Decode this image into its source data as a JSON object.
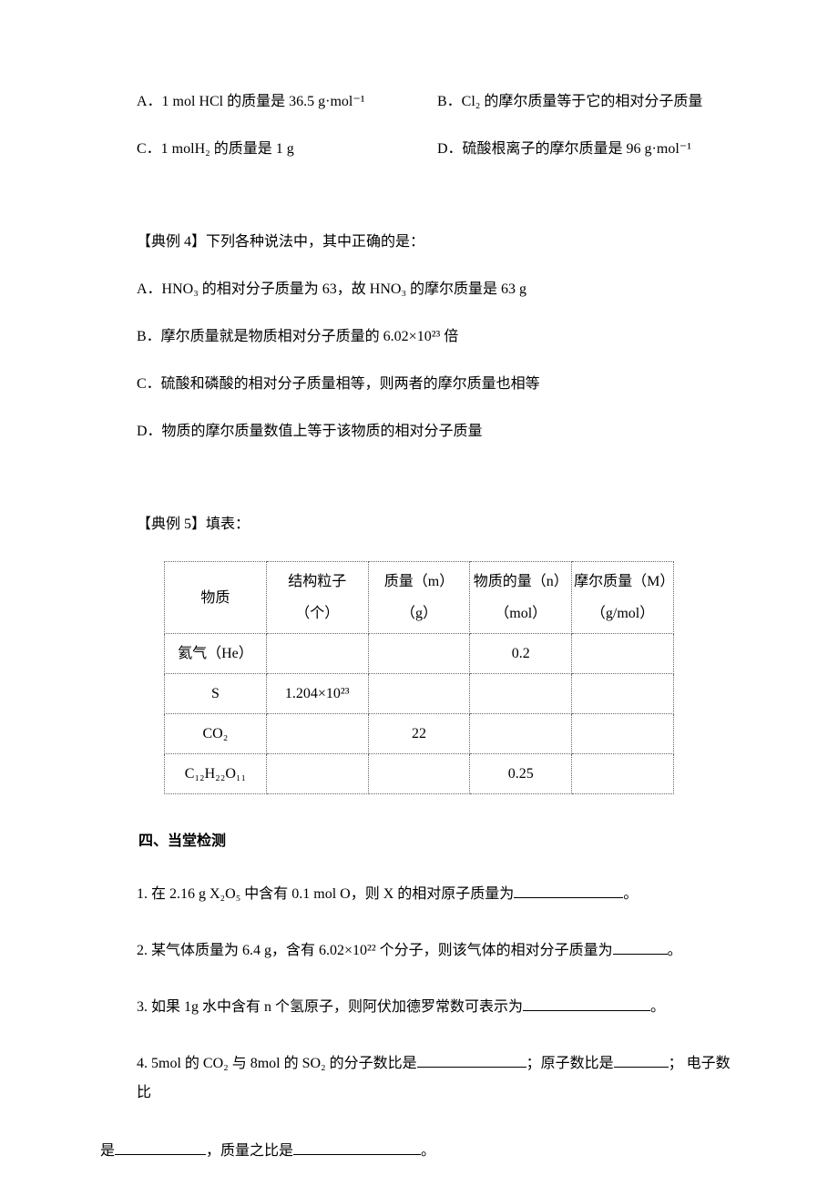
{
  "top": {
    "a": "A．1 mol HCl 的质量是 36.5 g·mol⁻¹",
    "b": "B．Cl₂ 的摩尔质量等于它的相对分子质量",
    "c": "C．1 molH₂ 的质量是 1 g",
    "d": "D．硫酸根离子的摩尔质量是 96 g·mol⁻¹"
  },
  "ex4": {
    "label": "【典例 4】下列各种说法中，其中正确的是：",
    "a": "A．HNO₃ 的相对分子质量为 63，故 HNO₃ 的摩尔质量是 63 g",
    "b": "B．摩尔质量就是物质相对分子质量的 6.02×10²³ 倍",
    "c": "C．硫酸和磷酸的相对分子质量相等，则两者的摩尔质量也相等",
    "d": "D．物质的摩尔质量数值上等于该物质的相对分子质量"
  },
  "ex5": {
    "label": "【典例 5】填表：",
    "headers": {
      "c0": {
        "main": "物质",
        "sub": ""
      },
      "c1": {
        "main": "结构粒子",
        "sub": "（个）"
      },
      "c2": {
        "main": "质量（m）",
        "sub": "（g）"
      },
      "c3": {
        "main": "物质的量（n）",
        "sub": "（mol）"
      },
      "c4": {
        "main": "摩尔质量（M）",
        "sub": "（g/mol）"
      }
    },
    "rows": [
      {
        "c0": "氦气（He）",
        "c1": "",
        "c2": "",
        "c3": "0.2",
        "c4": ""
      },
      {
        "c0": "S",
        "c1": "1.204×10²³",
        "c2": "",
        "c3": "",
        "c4": ""
      },
      {
        "c0": "CO₂",
        "c1": "",
        "c2": "22",
        "c3": "",
        "c4": ""
      },
      {
        "c0": "C₁₂H₂₂O₁₁",
        "c1": "",
        "c2": "",
        "c3": "0.25",
        "c4": ""
      }
    ]
  },
  "sec4": {
    "heading": "四、当堂检测",
    "q1a": "1.  在 2.16 g X₂O₅ 中含有 0.1 mol O，则 X 的相对原子质量为",
    "q1b": "。",
    "q2a": "2.  某气体质量为 6.4 g，含有 6.02×10²² 个分子，则该气体的相对分子质量为",
    "q2b": "。",
    "q3a": "3.  如果 1g 水中含有 n 个氢原子，则阿伏加德罗常数可表示为",
    "q3b": "。",
    "q4a": "4. 5mol 的 CO₂ 与 8mol 的 SO₂ 的分子数比是",
    "q4b": "；原子数比是",
    "q4c": "； 电子数比",
    "q4d": "是",
    "q4e": "，质量之比是",
    "q4f": "。"
  }
}
